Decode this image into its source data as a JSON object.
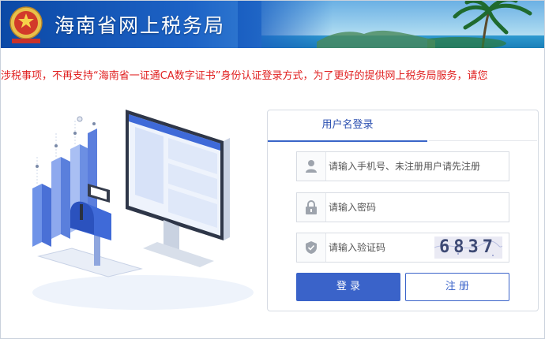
{
  "header": {
    "site_title": "海南省网上税务局",
    "emblem_icon": "tax-emblem-icon"
  },
  "notice": {
    "marquee": "涉税事项，不再支持“海南省一证通CA数字证书”身份认证登录方式，为了更好的提供网上税务局服务，请您"
  },
  "login": {
    "tab_label": "用户名登录",
    "phone_placeholder": "请输入手机号、未注册用户请先注册",
    "password_placeholder": "请输入密码",
    "captcha_placeholder": "请输入验证码",
    "captcha_code": "6837",
    "login_button": "登 录",
    "register_button": "注 册"
  },
  "colors": {
    "accent": "#3a63c9",
    "notice": "#e02020",
    "header_blue": "#1d63c6"
  }
}
